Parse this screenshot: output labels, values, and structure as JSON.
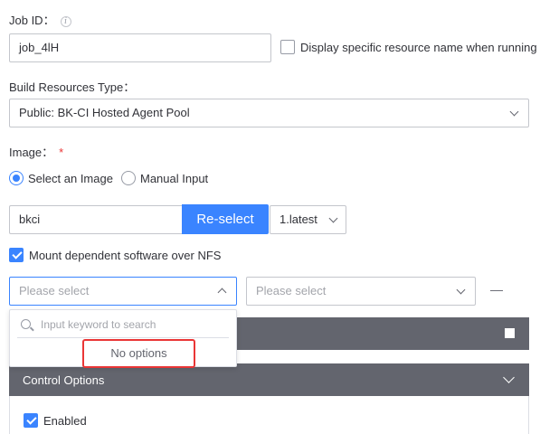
{
  "job_id": {
    "label": "Job ID：",
    "value": "job_4lH"
  },
  "display_resource": {
    "label": "Display specific resource name when running",
    "checked": false
  },
  "build_resources": {
    "label": "Build Resources Type：",
    "selected": "Public: BK-CI Hosted Agent Pool"
  },
  "image": {
    "label": "Image：",
    "required_mark": "*",
    "options": [
      "Select an Image",
      "Manual Input"
    ],
    "selected_option": "Select an Image",
    "name_value": "bkci",
    "reselect_label": "Re-select",
    "version": "1.latest"
  },
  "nfs": {
    "label": "Mount dependent software over NFS",
    "checked": true
  },
  "nfs_row": {
    "left_placeholder": "Please select",
    "right_placeholder": "Please select",
    "remove_symbol": "—"
  },
  "dropdown": {
    "search_placeholder": "Input keyword to search",
    "empty_text": "No options"
  },
  "control_options": {
    "title": "Control Options"
  },
  "enabled": {
    "label": "Enabled",
    "checked": true
  },
  "colors": {
    "primary": "#3a84ff",
    "panel_header": "#63656e",
    "highlight": "#ea3636"
  }
}
